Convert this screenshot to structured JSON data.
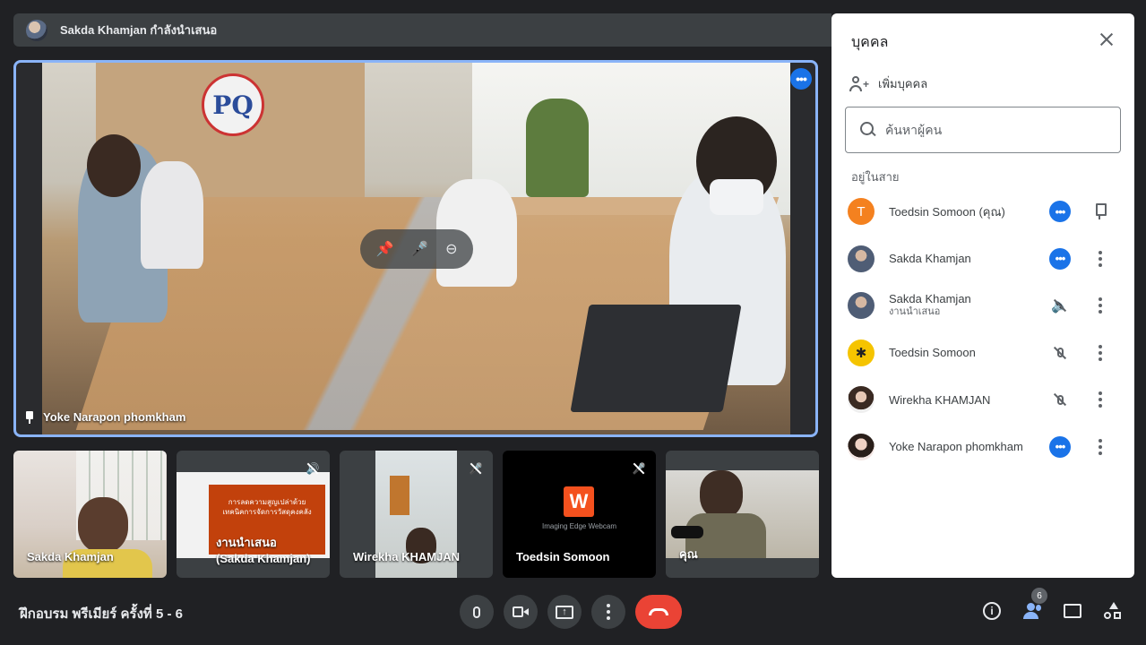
{
  "presenter": {
    "text": "Sakda Khamjan กำลังนำเสนอ"
  },
  "main_tile": {
    "participant": "Yoke Narapon phomkham",
    "logo_text": "PQ",
    "icons": {
      "more": "more-horiz-icon",
      "pin": "pin-icon",
      "pin_toggle": "pin-off-icon",
      "mic": "mic-icon",
      "remove": "remove-circle-icon"
    }
  },
  "thumbnails": [
    {
      "name": "Sakda Khamjan",
      "muted": false
    },
    {
      "name": "งานนำเสนอ\n(Sakda Khamjan)",
      "name_line1": "งานนำเสนอ",
      "name_line2": "(Sakda Khamjan)",
      "muted": true,
      "slide_title_line1": "การลดความสูญเปล่าด้วย",
      "slide_title_line2": "เทคนิคการจัดการวัสดุคงคลัง"
    },
    {
      "name": "Wirekha KHAMJAN",
      "muted": true
    },
    {
      "name": "Toedsin Somoon",
      "muted": true,
      "app_name": "Imaging Edge Webcam",
      "app_letter": "W"
    },
    {
      "name": "คุณ",
      "muted": false
    }
  ],
  "people_panel": {
    "title": "บุคคล",
    "add_label": "เพิ่มบุคคล",
    "search_placeholder": "ค้นหาผู้คน",
    "section_label": "อยู่ในสาย",
    "people": [
      {
        "name": "Toedsin Somoon (คุณ)",
        "subtitle": "",
        "avatar_letter": "T",
        "avatar_color": "#f4811f",
        "action1": "more-blue",
        "action2": "pin"
      },
      {
        "name": "Sakda Khamjan",
        "subtitle": "",
        "avatar_letter": "",
        "avatar_color": "#6b7a90",
        "action1": "more-blue",
        "action2": "vertical-dots"
      },
      {
        "name": "Sakda Khamjan",
        "subtitle": "งานนำเสนอ",
        "avatar_letter": "",
        "avatar_color": "#6b7a90",
        "action1": "volume-off",
        "action2": "vertical-dots"
      },
      {
        "name": "Toedsin Somoon",
        "subtitle": "",
        "avatar_letter": "",
        "avatar_color": "#f5c400",
        "action1": "mic-off",
        "action2": "vertical-dots"
      },
      {
        "name": "Wirekha KHAMJAN",
        "subtitle": "",
        "avatar_letter": "",
        "avatar_color": "#c9a48a",
        "action1": "mic-off",
        "action2": "vertical-dots"
      },
      {
        "name": "Yoke Narapon phomkham",
        "subtitle": "",
        "avatar_letter": "",
        "avatar_color": "#d8b7a8",
        "action1": "more-blue",
        "action2": "vertical-dots"
      }
    ]
  },
  "bottom_bar": {
    "meeting_title": "ฝึกอบรม พรีเมียร์ ครั้งที่ 5 - 6",
    "participant_count": "6",
    "buttons": [
      "mic-icon",
      "camera-icon",
      "present-screen-icon",
      "more-vert-icon",
      "end-call-icon",
      "info-icon",
      "people-icon",
      "chat-icon",
      "activities-icon"
    ]
  },
  "colors": {
    "accent": "#1a73e8",
    "danger": "#ea4335",
    "background": "#202124",
    "tile": "#3c4043",
    "highlight": "#8ab4f8"
  }
}
